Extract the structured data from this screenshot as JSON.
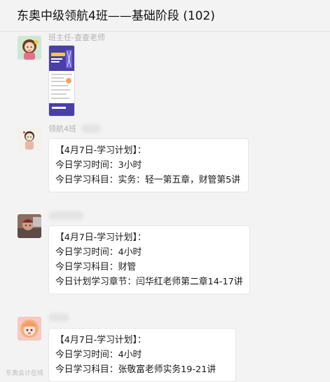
{
  "header": {
    "title": "东奥中级领航4班——基础阶段 (102)"
  },
  "messages": [
    {
      "sender": "班主任-查查老师",
      "avatar_icon": "girl-cartoon-avatar-icon",
      "type": "image"
    },
    {
      "sender": "领航4班",
      "avatar_icon": "cartoon-avatar-icon",
      "lines": [
        "【4月7日-学习计划】：",
        "今日学习时间：3小时",
        "今日学习科目：实务：轻一第五章，财管第5讲"
      ]
    },
    {
      "sender": "",
      "avatar_icon": "photo-avatar-icon",
      "lines": [
        "【4月7日-学习计划】：",
        "今日学习时间：4小时",
        "今日学习科目：财管",
        "今日计划学习章节：闫华红老师第二章14-17讲"
      ]
    },
    {
      "sender": "",
      "avatar_icon": "anime-girl-avatar-icon",
      "lines": [
        "【4月7日-学习计划】：",
        "今日学习时间：4小时",
        "今日学习科目：张敬富老师实务19-21讲"
      ]
    }
  ],
  "watermark": "东奥会计在线"
}
